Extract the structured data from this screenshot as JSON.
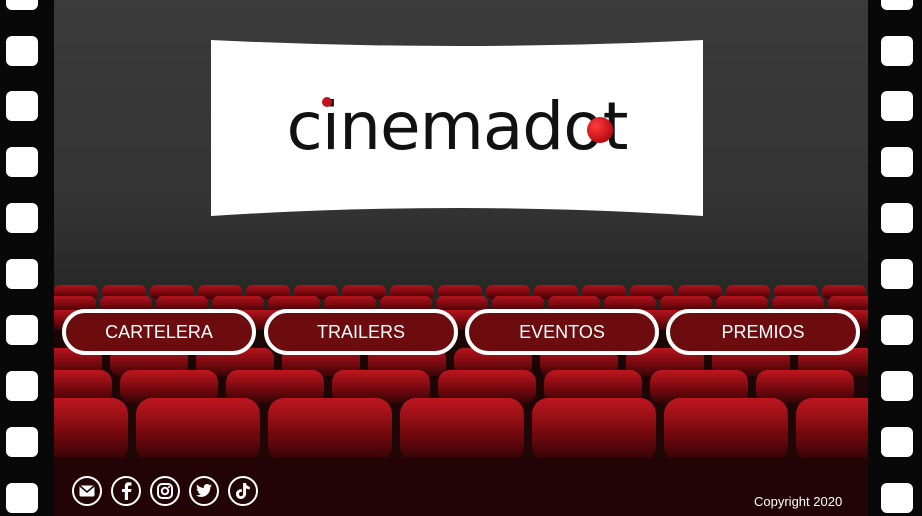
{
  "brand": {
    "logo_text": "cinemadot",
    "accent_color": "#c4121a"
  },
  "nav": {
    "items": [
      {
        "label": "CARTELERA"
      },
      {
        "label": "TRAILERS"
      },
      {
        "label": "EVENTOS"
      },
      {
        "label": "PREMIOS"
      }
    ]
  },
  "social": {
    "icons": [
      "email-icon",
      "facebook-icon",
      "instagram-icon",
      "twitter-icon",
      "tiktok-icon"
    ]
  },
  "footer": {
    "copyright": "Copyright 2020"
  }
}
